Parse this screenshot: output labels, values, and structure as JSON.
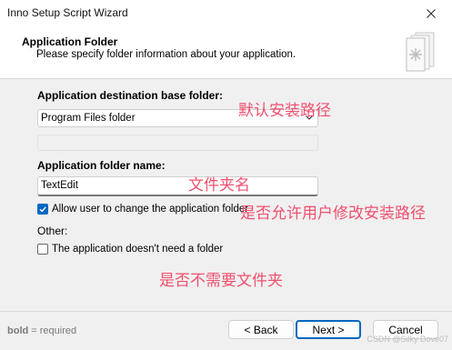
{
  "window": {
    "title": "Inno Setup Script Wizard"
  },
  "header": {
    "title": "Application Folder",
    "subtitle": "Please specify folder information about your application."
  },
  "form": {
    "dest_base_label": "Application destination base folder:",
    "dest_base_value": "Program Files folder",
    "folder_name_label": "Application folder name:",
    "folder_name_value": "TextEdit",
    "allow_change_label": "Allow user to change the application folder",
    "allow_change_checked": true,
    "other_label": "Other:",
    "no_folder_label": "The application doesn't need a folder",
    "no_folder_checked": false
  },
  "annotations": {
    "dest_default": "默认安装路径",
    "folder_name": "文件夹名",
    "allow_change": "是否允许用户修改安装路径",
    "no_folder": "是否不需要文件夹"
  },
  "footer": {
    "hint_bold": "bold",
    "hint_rest": " = required",
    "back_label": "< Back",
    "next_label": "Next >",
    "cancel_label": "Cancel"
  },
  "watermark": "CSDN @Silky Dove07",
  "colors": {
    "accent": "#0067c0",
    "annotation": "#f0506e"
  }
}
